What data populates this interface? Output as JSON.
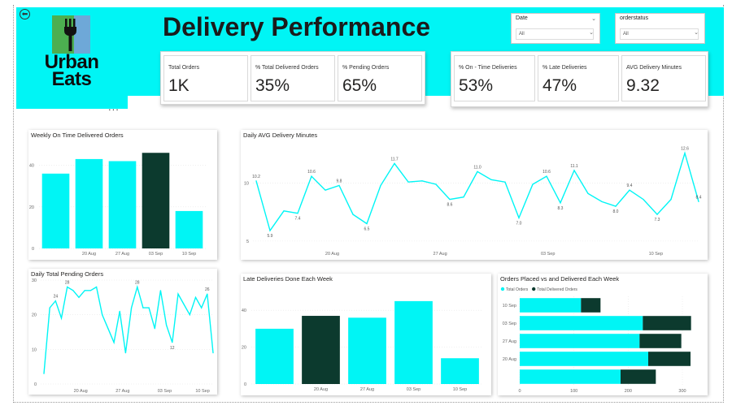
{
  "header": {
    "title": "Delivery Performance",
    "logo_text_line1": "Urban",
    "logo_text_line2": "Eats",
    "more_glyph": "...",
    "back_glyph": "⬅"
  },
  "colors": {
    "accent": "#00f5f5",
    "dark": "#0c3a2e",
    "logo_green": "#4caf50",
    "logo_blue": "#6ea8d8"
  },
  "icons": [
    "back-arrow-icon",
    "fork-icon",
    "more-options-icon",
    "chevron-down-icon"
  ],
  "slicers": {
    "date": {
      "label": "Date",
      "value": "All"
    },
    "orderstatus": {
      "label": "orderstatus",
      "value": "All"
    }
  },
  "kpis_left": [
    {
      "label": "Total Orders",
      "value": "1K"
    },
    {
      "label": "% Total Delivered Orders",
      "value": "35%"
    },
    {
      "label": "% Pending Orders",
      "value": "65%"
    }
  ],
  "kpis_right": [
    {
      "label": "% On - Time Deliveries",
      "value": "53%"
    },
    {
      "label": "% Late Deliveries",
      "value": "47%"
    },
    {
      "label": "AVG Delivery Minutes",
      "value": "9.32"
    }
  ],
  "chart_titles": {
    "weekly_on_time": "Weekly On Time Delivered Orders",
    "daily_avg": "Daily AVG Delivery Minutes",
    "daily_pending": "Daily Total Pending Orders",
    "late_weekly": "Late Deliveries Done Each Week",
    "placed_vs_delivered": "Orders Placed vs and Delivered Each Week"
  },
  "chart_data": [
    {
      "type": "bar",
      "title": "Weekly On Time Delivered Orders",
      "categories": [
        "",
        "20 Aug",
        "27 Aug",
        "03 Sep",
        "10 Sep"
      ],
      "bar_count": 5,
      "values": [
        36,
        43,
        42,
        46,
        18
      ],
      "highlight_index": 3,
      "ylim": [
        0,
        50
      ],
      "yticks": [
        "0",
        "20",
        "40"
      ],
      "ytick_values": [
        0,
        20,
        40
      ]
    },
    {
      "type": "line",
      "title": "Daily AVG Delivery Minutes",
      "values": [
        10.2,
        5.9,
        7.6,
        7.4,
        10.6,
        9.4,
        9.8,
        7.3,
        6.5,
        9.8,
        11.7,
        10.1,
        10.2,
        9.9,
        8.6,
        8.8,
        11.0,
        10.3,
        10.1,
        7.0,
        9.9,
        10.6,
        8.3,
        11.1,
        9.1,
        8.4,
        8.0,
        9.4,
        8.6,
        7.3,
        8.6,
        12.6,
        8.4
      ],
      "point_labels": [
        "10.2",
        "5.9",
        "",
        "7.4",
        "10.6",
        "",
        "9.8",
        "",
        "6.5",
        "",
        "11.7",
        "",
        "",
        "",
        "8.6",
        "",
        "11.0",
        "",
        "",
        "7.0",
        "",
        "10.6",
        "8.3",
        "11.1",
        "",
        "",
        "8.0",
        "9.4",
        "",
        "7.3",
        "",
        "12.6",
        "8.4"
      ],
      "xticks": [
        "20 Aug",
        "27 Aug",
        "03 Sep",
        "10 Sep"
      ],
      "xtick_index": [
        5.5,
        13.3,
        21.1,
        28.9
      ],
      "yticks": [
        "5",
        "10"
      ],
      "ytick_values": [
        5,
        10
      ],
      "ylim": [
        4.5,
        13.2
      ]
    },
    {
      "type": "line",
      "title": "Daily Total Pending Orders",
      "values": [
        3,
        22,
        24,
        19,
        28,
        27,
        25,
        27,
        27,
        28,
        20,
        16,
        12,
        21,
        9,
        22,
        28,
        22,
        22,
        16,
        27,
        17,
        12,
        26,
        23,
        20,
        25,
        22,
        26,
        9
      ],
      "point_labels": [
        "",
        "",
        "24",
        "",
        "28",
        "",
        "",
        "",
        "",
        "",
        "",
        "",
        "",
        "",
        "",
        "",
        "28",
        "",
        "",
        "",
        "",
        "",
        "12",
        "",
        "",
        "",
        "",
        "",
        "26",
        ""
      ],
      "xticks": [
        "20 Aug",
        "27 Aug",
        "03 Sep",
        "10 Sep"
      ],
      "xtick_index": [
        6.3,
        13.5,
        20.7,
        27.2
      ],
      "yticks": [
        "0",
        "10",
        "20",
        "30"
      ],
      "ytick_values": [
        0,
        10,
        20,
        30
      ],
      "ylim": [
        0,
        30
      ]
    },
    {
      "type": "bar",
      "title": "Late Deliveries Done Each Week",
      "categories": [
        "",
        "20 Aug",
        "27 Aug",
        "03 Sep",
        "10 Sep"
      ],
      "values": [
        30,
        37,
        36,
        45,
        14
      ],
      "highlight_index": 1,
      "ylim": [
        0,
        52
      ],
      "yticks": [
        "0",
        "20",
        "40"
      ],
      "ytick_values": [
        0,
        20,
        40
      ]
    },
    {
      "type": "bar",
      "orientation": "horizontal",
      "stacked": true,
      "title": "Orders Placed vs and Delivered Each Week",
      "categories": [
        "10 Sep",
        "03 Sep",
        "27 Aug",
        "20 Aug",
        ""
      ],
      "series": [
        {
          "name": "Total Orders",
          "values": [
            113,
            227,
            221,
            237,
            186
          ]
        },
        {
          "name": "Total Delivered Orders",
          "values": [
            36,
            89,
            77,
            78,
            65
          ]
        }
      ],
      "xticks": [
        "0",
        "100",
        "200",
        "300"
      ],
      "xtick_values": [
        0,
        100,
        200,
        300
      ],
      "xlim": [
        0,
        330
      ],
      "legend": "top-left"
    }
  ]
}
